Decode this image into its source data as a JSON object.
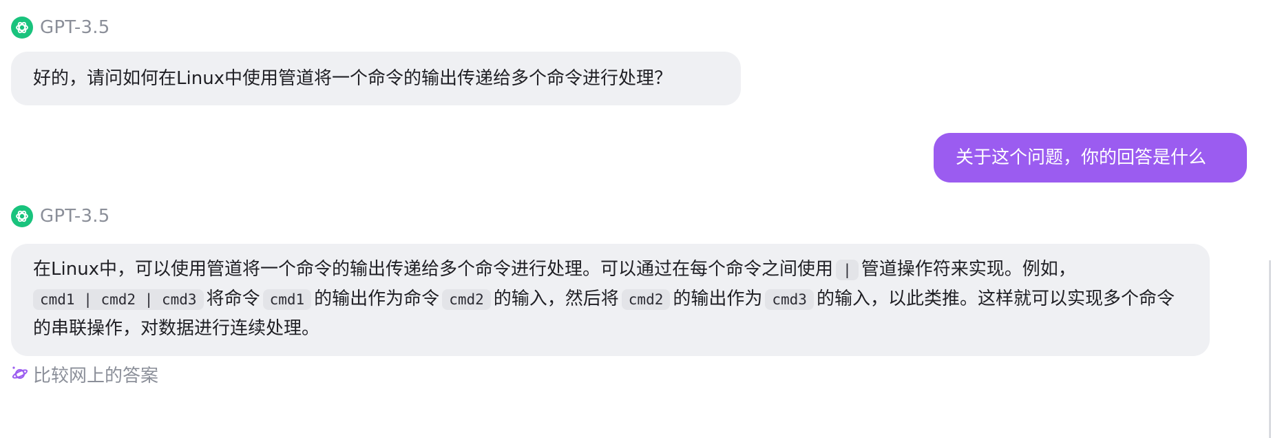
{
  "messages": {
    "bot1": {
      "name": "GPT-3.5",
      "icon": "openai-logo-icon"
    },
    "question1": "好的，请问如何在Linux中使用管道将一个命令的输出传递给多个命令进行处理？",
    "user_question": "关于这个问题，你的回答是什么",
    "bot2": {
      "name": "GPT-3.5",
      "icon": "openai-logo-icon"
    },
    "answer": {
      "seg1": "在Linux中，可以使用管道将一个命令的输出传递给多个命令进行处理。可以通过在每个命令之间使用",
      "pipe": "|",
      "seg2": "管道操作符来实现。例如，",
      "cmd_chain": "cmd1 | cmd2 | cmd3",
      "seg3": "将命令",
      "cmd1": "cmd1",
      "seg4": "的输出作为命令",
      "cmd2a": "cmd2",
      "seg5": "的输入，然后将",
      "cmd2b": "cmd2",
      "seg6": "的输出作为",
      "cmd3": "cmd3",
      "seg7": "的输入，以此类推。这样就可以实现多个命令的串联操作，对数据进行连续处理。"
    }
  },
  "compare": {
    "label": "比较网上的答案",
    "icon": "planet-icon"
  },
  "colors": {
    "assistant_bubble": "#eff0f3",
    "user_bubble": "#9b5cf0",
    "bot_icon": "#19c37d",
    "muted_text": "#8b8f99"
  }
}
